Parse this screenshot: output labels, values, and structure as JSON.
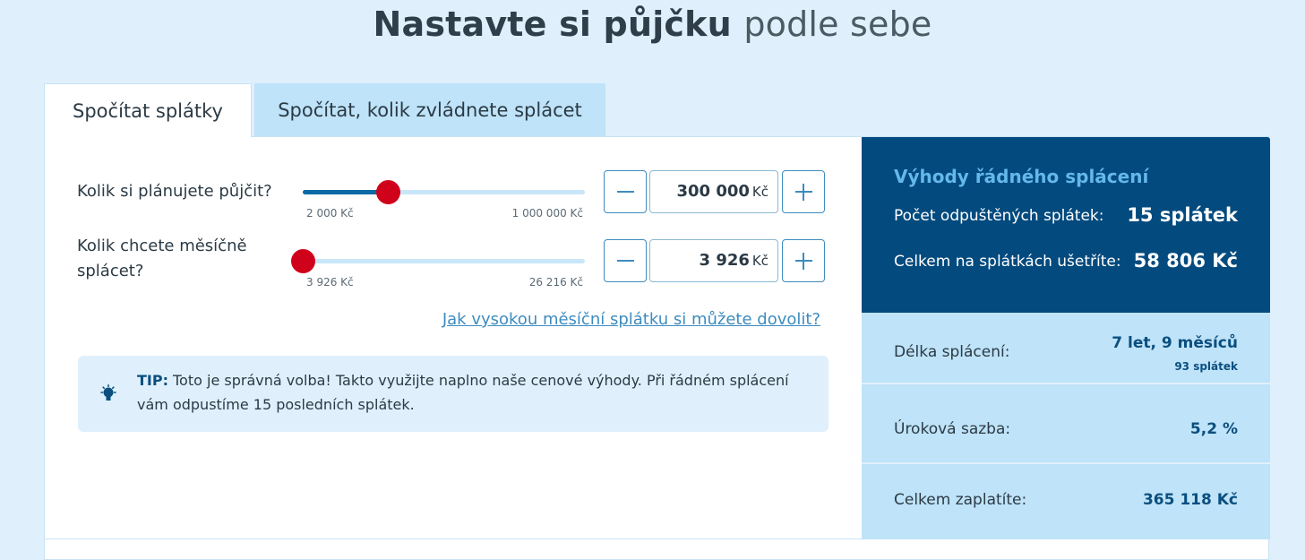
{
  "headline": {
    "bold": "Nastavte si půjčku",
    "light": "podle sebe"
  },
  "tabs": [
    {
      "label": "Spočítat splátky",
      "active": true
    },
    {
      "label": "Spočítat, kolik zvládnete splácet",
      "active": false
    }
  ],
  "loan": {
    "label": "Kolik si plánujete půjčit?",
    "min_label": "2 000 Kč",
    "max_label": "1 000 000 Kč",
    "value": "300 000",
    "unit": "Kč",
    "slider_fraction": 0.3
  },
  "monthly": {
    "label_line1": "Kolik chcete měsíčně",
    "label_line2": "splácet?",
    "min_label": "3 926 Kč",
    "max_label": "26 216 Kč",
    "value": "3 926",
    "unit": "Kč",
    "slider_fraction": 0.0
  },
  "afford_link": "Jak vysokou měsíční splátku si můžete dovolit?",
  "tip": {
    "label": "TIP:",
    "text": "Toto je správná volba! Takto využijte naplno naše cenové výhody. Při řádném splácení vám odpustíme 15 posledních splátek."
  },
  "benefits": {
    "title": "Výhody řádného splácení",
    "forgiven_label": "Počet odpuštěných splátek:",
    "forgiven_value": "15 splátek",
    "saved_label": "Celkem na splátkách ušetříte:",
    "saved_value": "58 806 Kč"
  },
  "summary": [
    {
      "label": "Délka splácení:",
      "value": "7 let, 9 měsíců",
      "sub": "93 splátek"
    },
    {
      "label": "Úroková sazba:",
      "value": "5,2 %"
    },
    {
      "label": "Celkem zaplatíte:",
      "value": "365 118 Kč"
    }
  ],
  "colors": {
    "accent": "#034a7e",
    "link": "#3d8cbf",
    "thumb": "#d0021b",
    "panel_light": "#bfe3f8"
  },
  "icons": {
    "minus": "minus-icon",
    "plus": "plus-icon",
    "tip": "lightbulb-icon"
  }
}
